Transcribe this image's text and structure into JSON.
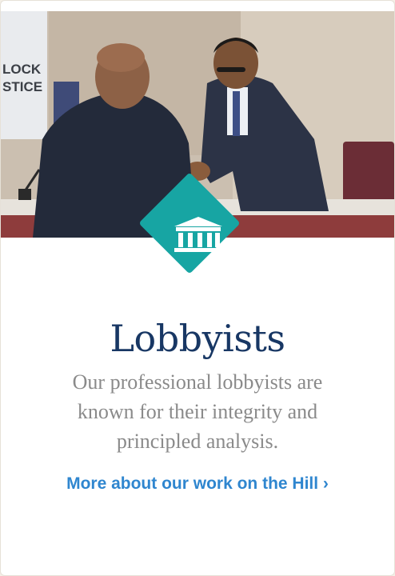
{
  "card": {
    "title": "Lobbyists",
    "description": "Our professional lobbyists are known for their integrity and principled analysis.",
    "link_label": "More about our work on the Hill ›",
    "badge_icon": "capitol-building-icon",
    "photo_screen_text_1": "LOCK",
    "photo_screen_text_2": "STICE"
  },
  "colors": {
    "badge": "#17a5a3",
    "title": "#183764",
    "description": "#8a8a8a",
    "link": "#2f86cf"
  }
}
